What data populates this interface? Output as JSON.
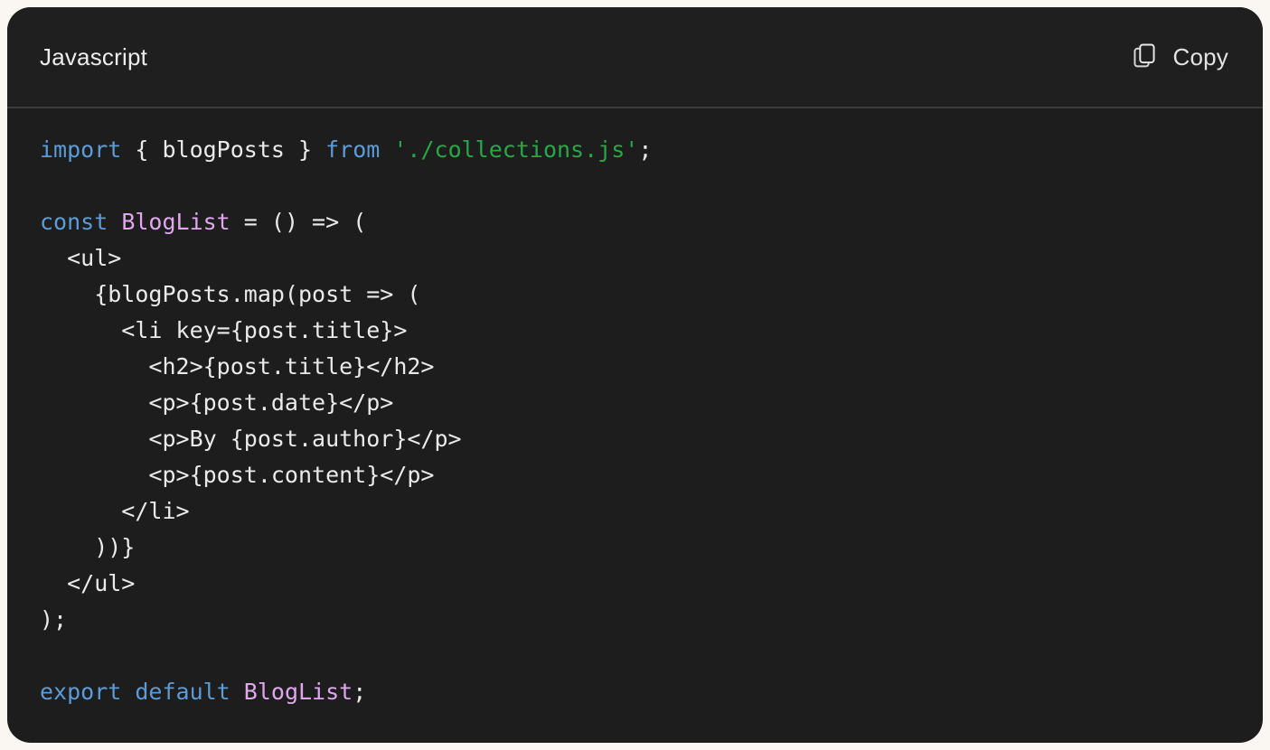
{
  "header": {
    "language_label": "Javascript",
    "copy_label": "Copy",
    "copy_icon": "copy-icon"
  },
  "colors": {
    "page_background": "#faf6f1",
    "panel_background": "#1d1d1d",
    "header_background": "#1f1f1f",
    "divider": "#3b3b3b",
    "keyword": "#5b9bd8",
    "function_name": "#e2a6ef",
    "string": "#29a745",
    "plain_text": "#e6e6e6",
    "header_text": "#ececec"
  },
  "code": {
    "language": "Javascript",
    "lines": [
      {
        "n": 1,
        "tokens": [
          {
            "t": "import",
            "c": "kw"
          },
          {
            "t": " { blogPosts } ",
            "c": "pl"
          },
          {
            "t": "from",
            "c": "kw"
          },
          {
            "t": " ",
            "c": "pl"
          },
          {
            "t": "'./collections.js'",
            "c": "str"
          },
          {
            "t": ";",
            "c": "pl"
          }
        ]
      },
      {
        "n": 2,
        "tokens": []
      },
      {
        "n": 3,
        "tokens": [
          {
            "t": "const",
            "c": "kw"
          },
          {
            "t": " ",
            "c": "pl"
          },
          {
            "t": "BlogList",
            "c": "fn"
          },
          {
            "t": " = () => (",
            "c": "pl"
          }
        ]
      },
      {
        "n": 4,
        "tokens": [
          {
            "t": "  <ul>",
            "c": "pl"
          }
        ]
      },
      {
        "n": 5,
        "tokens": [
          {
            "t": "    {blogPosts.map(post => (",
            "c": "pl"
          }
        ]
      },
      {
        "n": 6,
        "tokens": [
          {
            "t": "      <li key={post.title}>",
            "c": "pl"
          }
        ]
      },
      {
        "n": 7,
        "tokens": [
          {
            "t": "        <h2>{post.title}</h2>",
            "c": "pl"
          }
        ]
      },
      {
        "n": 8,
        "tokens": [
          {
            "t": "        <p>{post.date}</p>",
            "c": "pl"
          }
        ]
      },
      {
        "n": 9,
        "tokens": [
          {
            "t": "        <p>By {post.author}</p>",
            "c": "pl"
          }
        ]
      },
      {
        "n": 10,
        "tokens": [
          {
            "t": "        <p>{post.content}</p>",
            "c": "pl"
          }
        ]
      },
      {
        "n": 11,
        "tokens": [
          {
            "t": "      </li>",
            "c": "pl"
          }
        ]
      },
      {
        "n": 12,
        "tokens": [
          {
            "t": "    ))}",
            "c": "pl"
          }
        ]
      },
      {
        "n": 13,
        "tokens": [
          {
            "t": "  </ul>",
            "c": "pl"
          }
        ]
      },
      {
        "n": 14,
        "tokens": [
          {
            "t": ");",
            "c": "pl"
          }
        ]
      },
      {
        "n": 15,
        "tokens": []
      },
      {
        "n": 16,
        "tokens": [
          {
            "t": "export",
            "c": "kw"
          },
          {
            "t": " ",
            "c": "pl"
          },
          {
            "t": "default",
            "c": "kw"
          },
          {
            "t": " ",
            "c": "pl"
          },
          {
            "t": "BlogList",
            "c": "fn"
          },
          {
            "t": ";",
            "c": "pl"
          }
        ]
      }
    ]
  }
}
